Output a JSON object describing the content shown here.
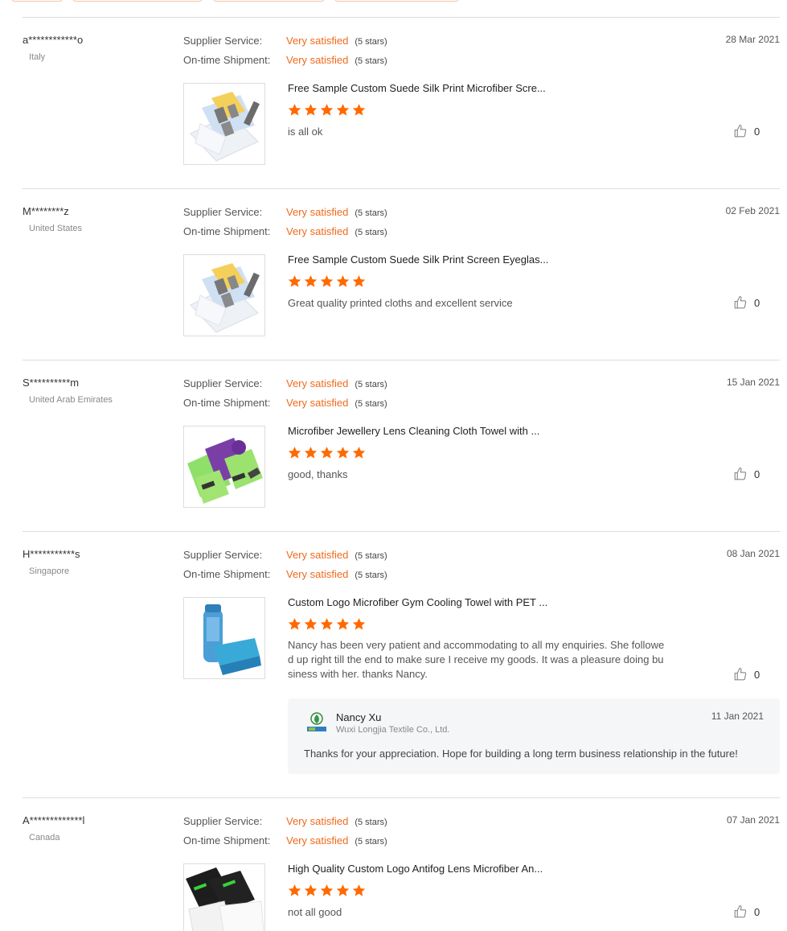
{
  "colors": {
    "accent": "#f06a1b",
    "star": "#ff6a00",
    "divider": "#dddddd",
    "reply_bg": "#f5f6f8"
  },
  "labels": {
    "supplier_service": "Supplier Service:",
    "ontime_shipment": "On-time Shipment:"
  },
  "reviews": [
    {
      "buyer": "a************o",
      "country": "Italy",
      "date": "28 Mar 2021",
      "supplier_rating": "Very satisfied",
      "supplier_stars": "(5 stars)",
      "shipment_rating": "Very satisfied",
      "shipment_stars": "(5 stars)",
      "product_title": "Free Sample Custom Suede Silk Print Microfiber Scre...",
      "product_image": "microfiber-cloth-samples",
      "rating": 5,
      "text": "is all ok",
      "likes": "0"
    },
    {
      "buyer": "M********z",
      "country": "United States",
      "date": "02 Feb 2021",
      "supplier_rating": "Very satisfied",
      "supplier_stars": "(5 stars)",
      "shipment_rating": "Very satisfied",
      "shipment_stars": "(5 stars)",
      "product_title": "Free Sample Custom Suede Silk Print Screen Eyeglas...",
      "product_image": "microfiber-cloth-samples",
      "rating": 5,
      "text": "Great quality printed cloths and excellent service",
      "likes": "0"
    },
    {
      "buyer": "S**********m",
      "country": "United Arab Emirates",
      "date": "15 Jan 2021",
      "supplier_rating": "Very satisfied",
      "supplier_stars": "(5 stars)",
      "shipment_rating": "Very satisfied",
      "shipment_stars": "(5 stars)",
      "product_title": "Microfiber Jewellery Lens Cleaning Cloth Towel with ...",
      "product_image": "printed-cleaning-cloths",
      "rating": 5,
      "text": "good, thanks",
      "likes": "0"
    },
    {
      "buyer": "H***********s",
      "country": "Singapore",
      "date": "08 Jan 2021",
      "supplier_rating": "Very satisfied",
      "supplier_stars": "(5 stars)",
      "shipment_rating": "Very satisfied",
      "shipment_stars": "(5 stars)",
      "product_title": "Custom Logo Microfiber Gym Cooling Towel with PET ...",
      "product_image": "cooling-towel-bottle",
      "rating": 5,
      "text_lines": [
        "Nancy has been very patient and accommodating to all my enquiries. She followe",
        "d up right till the end to make sure I receive my goods. It was a pleasure doing bu",
        "siness with her. thanks Nancy."
      ],
      "likes": "0",
      "reply": {
        "name": "Nancy Xu",
        "company": "Wuxi Longjia Textile Co., Ltd.",
        "date": "11 Jan 2021",
        "text": "Thanks for your appreciation. Hope for building a long term business relationship in the future!"
      }
    },
    {
      "buyer": "A*************l",
      "country": "Canada",
      "date": "07 Jan 2021",
      "supplier_rating": "Very satisfied",
      "supplier_stars": "(5 stars)",
      "shipment_rating": "Very satisfied",
      "shipment_stars": "(5 stars)",
      "product_title": "High Quality Custom Logo Antifog Lens Microfiber An...",
      "product_image": "antifog-cloth-packs",
      "rating": 5,
      "text": "not all good",
      "likes": "0"
    }
  ]
}
